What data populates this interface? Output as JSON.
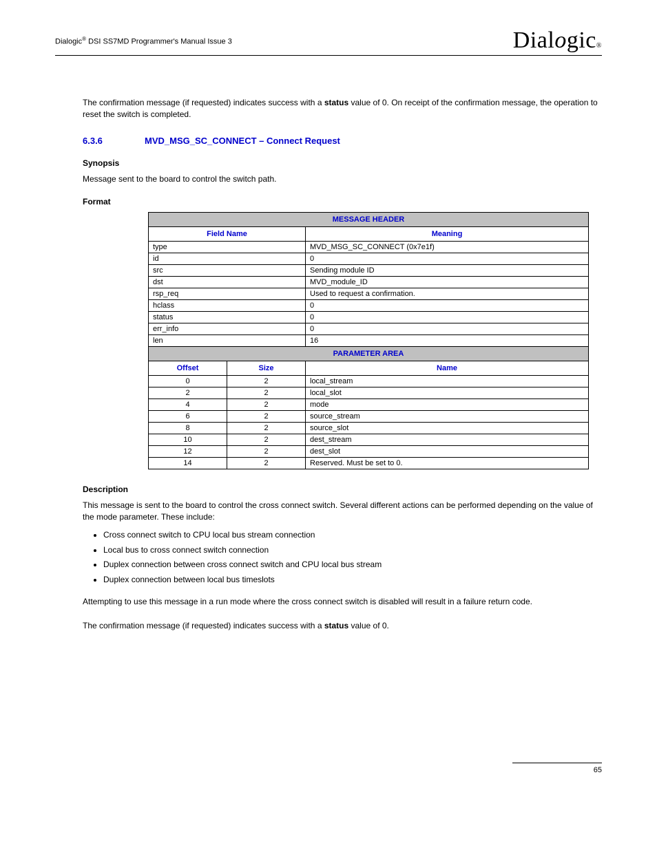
{
  "header": {
    "product_prefix": "Dialogic",
    "product_suffix": " DSI SS7MD Programmer's Manual  Issue 3",
    "logo_text": "Dialogic",
    "logo_reg": "®"
  },
  "intro": {
    "text_before": "The confirmation message (if requested) indicates success with a ",
    "bold": "status",
    "text_after": " value of 0. On receipt of the confirmation message, the operation to reset the switch is completed."
  },
  "section": {
    "number": "6.3.6",
    "title": "MVD_MSG_SC_CONNECT – Connect Request"
  },
  "synopsis": {
    "heading": "Synopsis",
    "text": "Message sent to the board to control the switch path."
  },
  "format": {
    "heading": "Format",
    "msg_header_title": "MESSAGE HEADER",
    "col_field_name": "Field Name",
    "col_meaning": "Meaning",
    "rows": [
      {
        "field": "type",
        "meaning": "MVD_MSG_SC_CONNECT (0x7e1f)"
      },
      {
        "field": "id",
        "meaning": "0"
      },
      {
        "field": "src",
        "meaning": "Sending module ID"
      },
      {
        "field": "dst",
        "meaning": "MVD_module_ID"
      },
      {
        "field": "rsp_req",
        "meaning": "Used to request a confirmation."
      },
      {
        "field": "hclass",
        "meaning": "0"
      },
      {
        "field": "status",
        "meaning": "0"
      },
      {
        "field": "err_info",
        "meaning": "0"
      },
      {
        "field": "len",
        "meaning": "16"
      }
    ],
    "param_area_title": "PARAMETER AREA",
    "col_offset": "Offset",
    "col_size": "Size",
    "col_name": "Name",
    "params": [
      {
        "offset": "0",
        "size": "2",
        "name": "local_stream"
      },
      {
        "offset": "2",
        "size": "2",
        "name": "local_slot"
      },
      {
        "offset": "4",
        "size": "2",
        "name": "mode"
      },
      {
        "offset": "6",
        "size": "2",
        "name": "source_stream"
      },
      {
        "offset": "8",
        "size": "2",
        "name": "source_slot"
      },
      {
        "offset": "10",
        "size": "2",
        "name": "dest_stream"
      },
      {
        "offset": "12",
        "size": "2",
        "name": "dest_slot"
      },
      {
        "offset": "14",
        "size": "2",
        "name": "Reserved. Must be set to 0."
      }
    ]
  },
  "description": {
    "heading": "Description",
    "para1": "This message is sent to the board to control the cross connect switch. Several different actions can be performed depending on the value of the mode parameter. These include:",
    "bullets": [
      "Cross connect switch to CPU local bus stream connection",
      "Local bus to cross connect switch connection",
      "Duplex connection between cross connect switch and CPU local bus stream",
      "Duplex connection between local bus timeslots"
    ],
    "para2": "Attempting to use this message in a run mode where the cross connect switch is disabled will result in a failure return code.",
    "para3_before": "The confirmation message (if requested) indicates success with a ",
    "para3_bold": "status",
    "para3_after": " value of 0."
  },
  "footer": {
    "page": "65"
  }
}
